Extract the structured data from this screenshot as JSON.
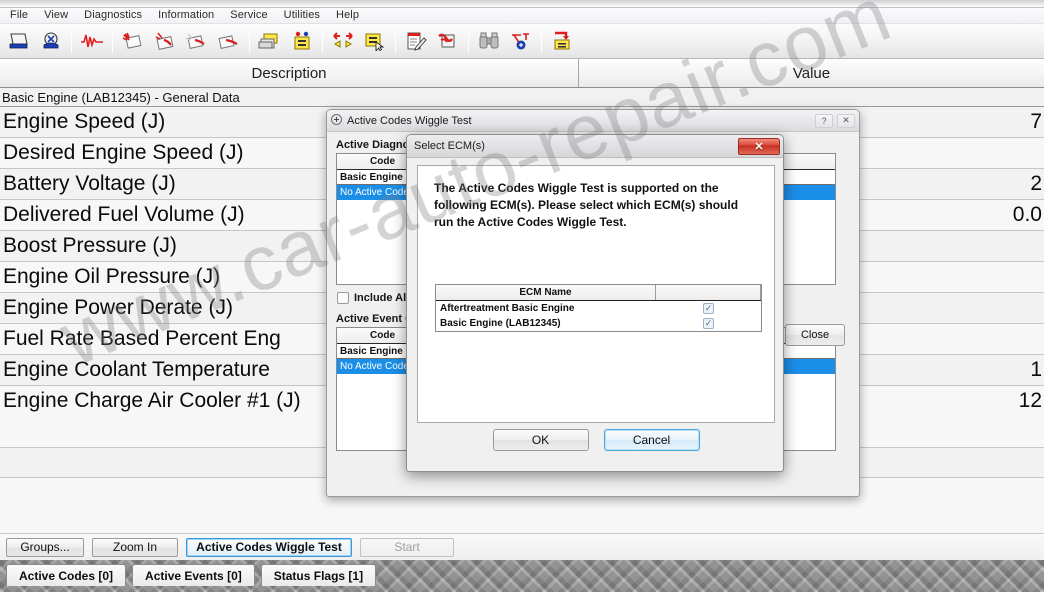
{
  "menu": {
    "items": [
      "File",
      "View",
      "Diagnostics",
      "Information",
      "Service",
      "Utilities",
      "Help"
    ]
  },
  "toolbar": {
    "buttons": [
      {
        "name": "open-file-icon",
        "tip": "Open"
      },
      {
        "name": "connect-ecm-icon",
        "tip": "Connect"
      },
      {
        "name": "waveform-icon",
        "tip": "Graph"
      },
      {
        "name": "diagnostic-codes-icon",
        "tip": "Active Codes"
      },
      {
        "name": "logged-codes-icon",
        "tip": "Logged Codes"
      },
      {
        "name": "events-icon",
        "tip": "Active Events"
      },
      {
        "name": "logged-events-icon",
        "tip": "Logged Events"
      },
      {
        "name": "configuration-icon",
        "tip": "Configuration"
      },
      {
        "name": "ecm-summary-icon",
        "tip": "ECM Summary"
      },
      {
        "name": "compare-icon",
        "tip": "Compare"
      },
      {
        "name": "ecm-select-icon",
        "tip": "Select ECM"
      },
      {
        "name": "notes-icon",
        "tip": "Notes"
      },
      {
        "name": "wiring-icon",
        "tip": "Wiring"
      },
      {
        "name": "binoculars-icon",
        "tip": "Search"
      },
      {
        "name": "test-icon",
        "tip": "Diagnostic Test"
      },
      {
        "name": "flash-icon",
        "tip": "Flash"
      }
    ]
  },
  "grid": {
    "headers": {
      "description": "Description",
      "value": "Value"
    },
    "group": "Basic Engine (LAB12345) - General Data",
    "rows": [
      {
        "description": "Engine Speed (J)",
        "value": "7"
      },
      {
        "description": "Desired Engine Speed (J)",
        "value": ""
      },
      {
        "description": "Battery Voltage (J)",
        "value": "2"
      },
      {
        "description": "Delivered Fuel Volume (J)",
        "value": "0.0"
      },
      {
        "description": "Boost Pressure (J)",
        "value": ""
      },
      {
        "description": "Engine Oil Pressure (J)",
        "value": ""
      },
      {
        "description": "Engine Power Derate (J)",
        "value": ""
      },
      {
        "description": "Fuel Rate Based Percent Eng",
        "value": ""
      },
      {
        "description": "Engine Coolant Temperature",
        "value": "1"
      },
      {
        "description": "Engine Charge Air Cooler #1 (J)",
        "value": "12"
      }
    ]
  },
  "watermark": {
    "text": "www.car-auto-repair.com"
  },
  "bottom_buttons": [
    {
      "label": "Groups...",
      "state": "normal"
    },
    {
      "label": "Zoom In",
      "state": "normal"
    },
    {
      "label": "Active Codes Wiggle Test",
      "state": "focused"
    },
    {
      "label": "Start",
      "state": "disabled"
    }
  ],
  "tabs": [
    {
      "label": "Active Codes [0]"
    },
    {
      "label": "Active Events [0]"
    },
    {
      "label": "Status Flags [1]"
    }
  ],
  "wiggle_dialog": {
    "title": "Active Codes Wiggle Test",
    "help_glyph": "?",
    "close_glyph": "✕",
    "diagnostic_section_label": "Active Diagnostic Codes",
    "event_section_label": "Active Event Codes",
    "code_column": "Code",
    "ecm_group_row": "Basic Engine (LAB12345)",
    "no_active_row": "No Active Codes",
    "include_label": "Include All Codes",
    "close_label": "Close"
  },
  "ecm_dialog": {
    "title": "Select ECM(s)",
    "close_glyph": "✕",
    "message": "The Active Codes Wiggle Test is supported on the following ECM(s).  Please select which ECM(s) should run the Active Codes Wiggle Test.",
    "table_header": "ECM Name",
    "ecms": [
      {
        "name": "Aftertreatment Basic Engine",
        "checked": true
      },
      {
        "name": "Basic Engine (LAB12345)",
        "checked": true
      }
    ],
    "ok_label": "OK",
    "cancel_label": "Cancel"
  },
  "colors": {
    "selection_blue": "#1b8fe8",
    "focus_blue": "#3c99dc",
    "close_red": "#d9493a"
  }
}
